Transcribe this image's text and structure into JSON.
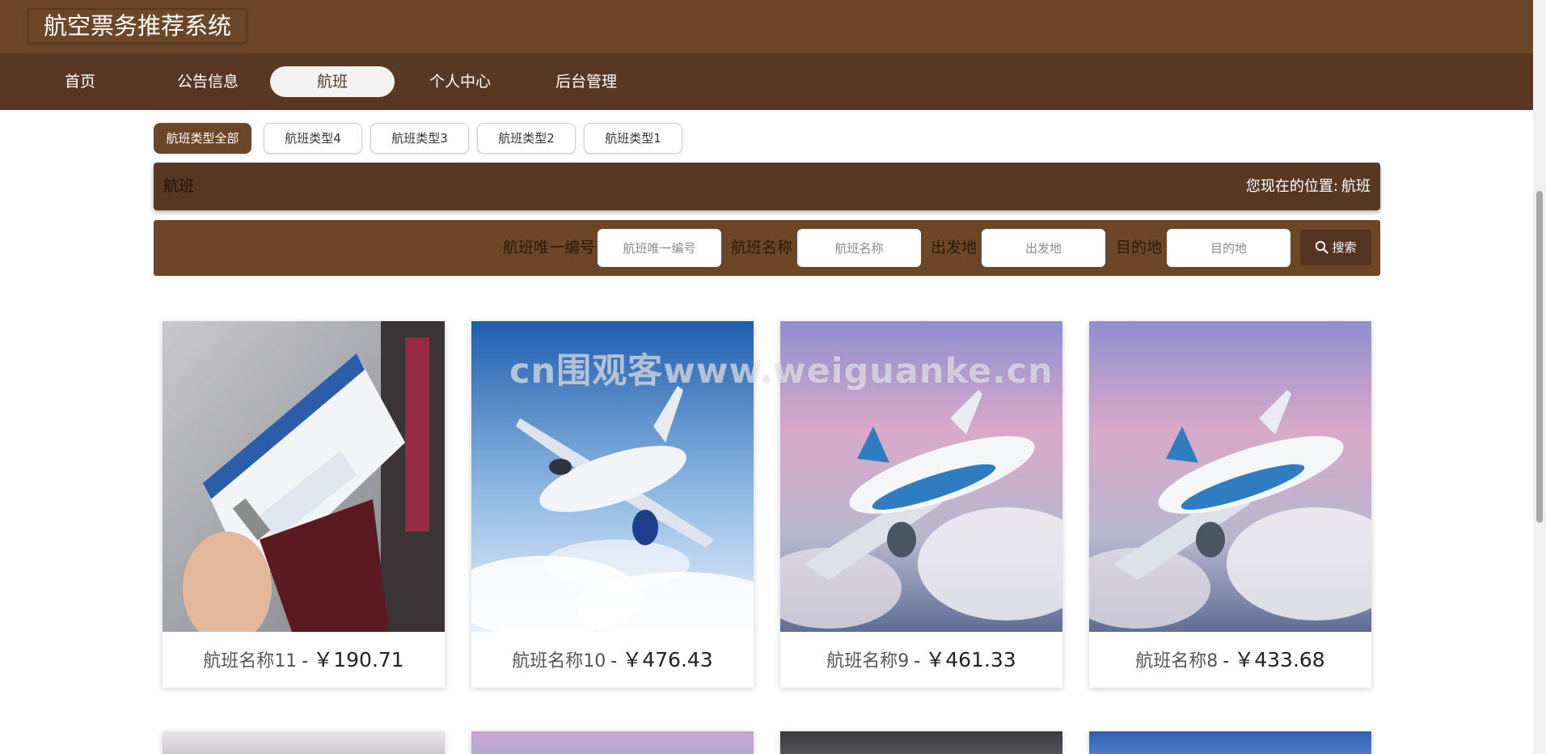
{
  "app": {
    "title": "航空票务推荐系统"
  },
  "nav": {
    "items": [
      {
        "label": "首页"
      },
      {
        "label": "公告信息"
      },
      {
        "label": "航班",
        "active": true
      },
      {
        "label": "个人中心"
      },
      {
        "label": "后台管理"
      }
    ]
  },
  "categories": [
    {
      "label": "航班类型全部",
      "active": true
    },
    {
      "label": "航班类型4"
    },
    {
      "label": "航班类型3"
    },
    {
      "label": "航班类型2"
    },
    {
      "label": "航班类型1"
    }
  ],
  "section": {
    "title": "航班",
    "location_label": "您现在的位置:",
    "location_value": "航班"
  },
  "search": {
    "fields": [
      {
        "label": "航班唯一编号",
        "placeholder": "航班唯一编号",
        "value": ""
      },
      {
        "label": "航班名称",
        "placeholder": "航班名称",
        "value": ""
      },
      {
        "label": "出发地",
        "placeholder": "出发地",
        "value": ""
      },
      {
        "label": "目的地",
        "placeholder": "目的地",
        "value": ""
      }
    ],
    "button_label": "搜索",
    "button_icon": "search-icon"
  },
  "flights": [
    {
      "name": "航班名称11",
      "price": "￥190.71",
      "image": "boarding-pass-passport-photo"
    },
    {
      "name": "航班名称10",
      "price": "￥476.43",
      "image": "airplane-blue-sky-photo"
    },
    {
      "name": "航班名称9",
      "price": "￥461.33",
      "image": "airplane-pink-clouds-photo"
    },
    {
      "name": "航班名称8",
      "price": "￥433.68",
      "image": "airplane-pink-clouds-photo"
    }
  ],
  "watermark": "cn围观客www.weiguanke.cn",
  "colors": {
    "header": "#6b4728",
    "nav": "#593823",
    "active_pill": "#f3f3f3",
    "search_button": "#533420"
  }
}
